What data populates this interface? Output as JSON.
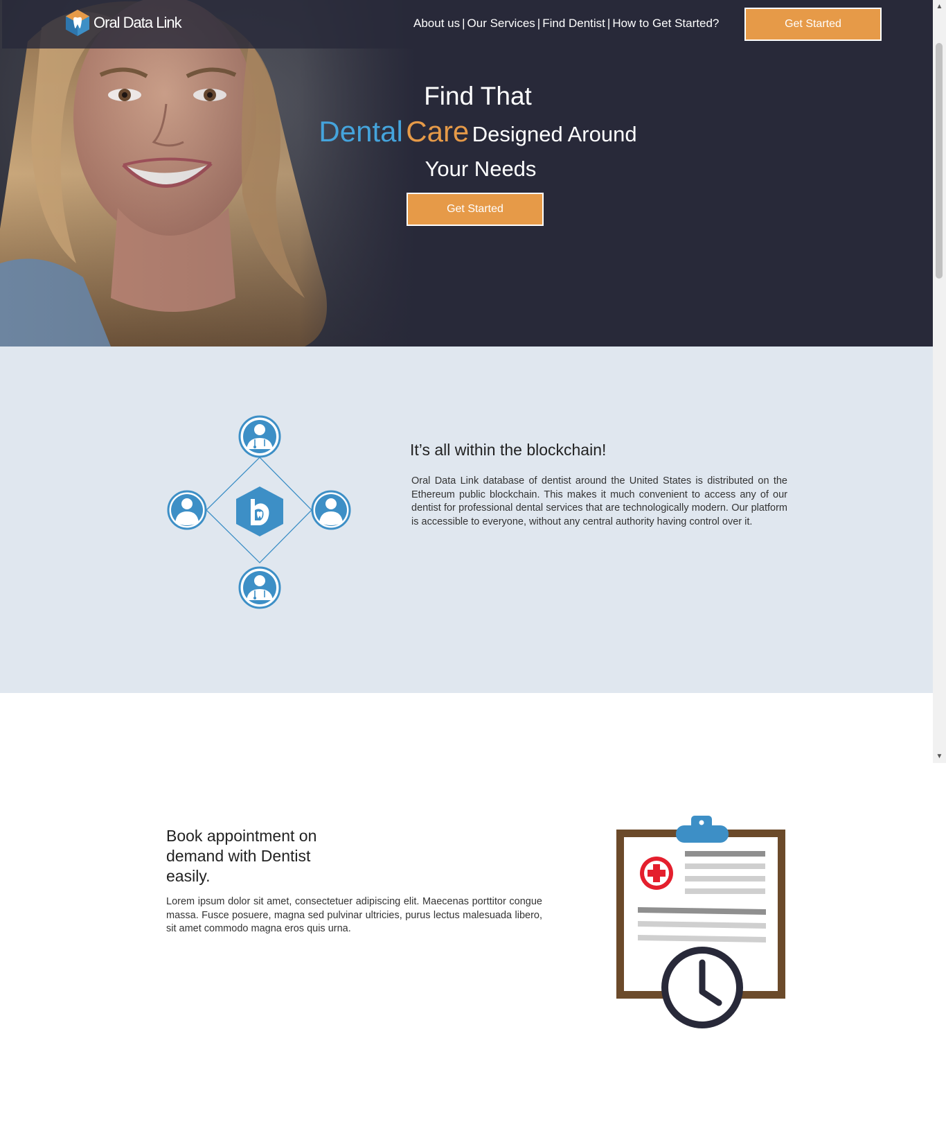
{
  "brand": {
    "name": "Oral Data Link",
    "colors": {
      "accent_orange": "#e69a48",
      "accent_blue": "#45a4dc",
      "dark": "#282939",
      "light_bg": "#e0e7ef",
      "icon_blue": "#3d8fc6"
    }
  },
  "nav": {
    "links": [
      "About us",
      "Our Services",
      "Find Dentist",
      "How to Get Started?"
    ],
    "separator": "|",
    "cta_label": "Get Started"
  },
  "hero": {
    "line1": "Find That",
    "dental": "Dental",
    "care": "Care",
    "designed": "Designed Around",
    "line3": "Your Needs",
    "cta_label": "Get Started"
  },
  "blockchain": {
    "title": "It’s all within the blockchain!",
    "body": "Oral Data Link database of dentist around the United States is distributed on the Ethereum public blockchain. This makes it much convenient to access any of our dentist for professional dental services that are technologically modern. Our platform is accessible to everyone, without any central authority having control over it.",
    "icons": [
      "dentist-icon",
      "user-icon",
      "user-icon",
      "dentist-icon",
      "logo-hex-icon"
    ]
  },
  "booking": {
    "title": "Book appointment on demand with Dentist easily.",
    "body": "Lorem ipsum dolor sit amet, consectetuer adipiscing elit. Maecenas porttitor congue massa. Fusce posuere, magna sed pulvinar ultricies, purus lectus malesuada libero, sit amet commodo magna eros quis urna.",
    "icon": "clipboard-clock-icon"
  },
  "scrollbar": {
    "up_icon": "▲",
    "down_icon": "▼"
  }
}
